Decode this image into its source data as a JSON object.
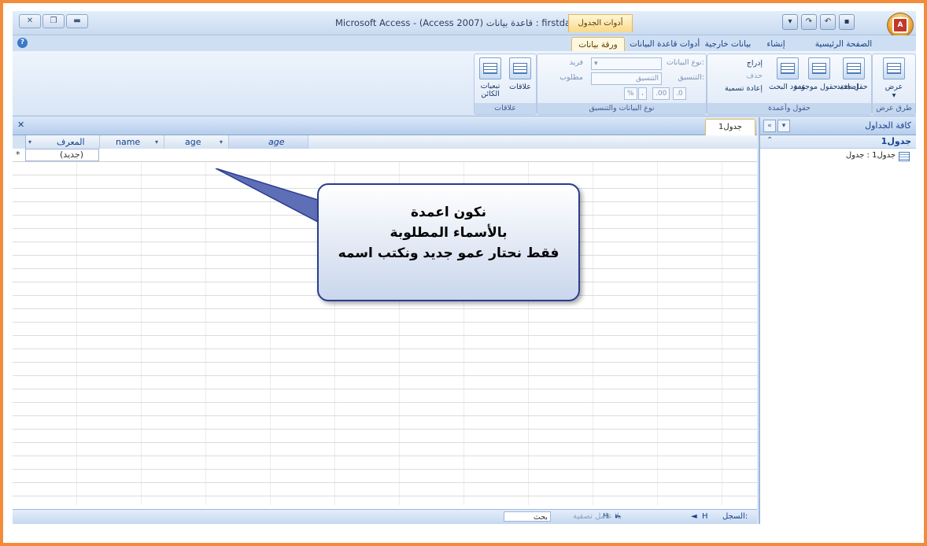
{
  "window": {
    "title": "Microsoft Access - (Access 2007) قاعدة بيانات : firstdatabase",
    "context_tab": "أدوات الجدول"
  },
  "ribbon_tabs": [
    {
      "label": "الصفحة الرئيسية"
    },
    {
      "label": "إنشاء"
    },
    {
      "label": "بيانات خارجية"
    },
    {
      "label": "أدوات قاعدة البيانات"
    },
    {
      "label": "ورقة بيانات"
    }
  ],
  "ribbon": {
    "views": {
      "label": "طرق عرض",
      "view_button": "عرض"
    },
    "fields_columns": {
      "label": "حقول وأعمدة",
      "new_field": "حقل جديد",
      "add_existing": "إضافة حقول موجودة",
      "lookup_column": "عمود البحث",
      "insert": "إدراج",
      "delete": "حذف",
      "rename": "إعادة تسمية"
    },
    "data_type_format": {
      "label": "نوع البيانات والتنسيق",
      "data_type_label": "نوع البيانات:",
      "format_label": "التنسيق:",
      "format_value": "التنسيق",
      "unique": "فريد",
      "required": "مطلوب",
      "percent": "%",
      "comma": "،"
    },
    "relationships": {
      "label": "علاقات",
      "relationships_btn": "علاقات",
      "object_dependencies": "تبعيات الكائن"
    }
  },
  "nav_pane": {
    "title": "كافة الجداول",
    "group": "جدول1",
    "item": "جدول1 : جدول"
  },
  "document": {
    "tab": "جدول1",
    "columns": [
      {
        "name": "المعرف"
      },
      {
        "name": "name"
      },
      {
        "name": "age"
      },
      {
        "name": "age"
      }
    ],
    "new_row_marker": "*",
    "new_row_value": "(جديد)"
  },
  "statusbar": {
    "record_label": "السجل:",
    "nav_first": "H",
    "nav_prev": "◄",
    "nav_next": "►",
    "nav_last": "H",
    "filter": "بلا عامل تصفية",
    "search": "بحث"
  },
  "callout": {
    "line1": "نكون اعمدة",
    "line2": "بالأسماء المطلوبة",
    "line3": "فقط نحتار عمو جديد ونكتب اسمه"
  },
  "colors": {
    "frame_border": "#f28c3a",
    "ribbon_text": "#15428b",
    "callout_border": "#2a3d8f"
  }
}
